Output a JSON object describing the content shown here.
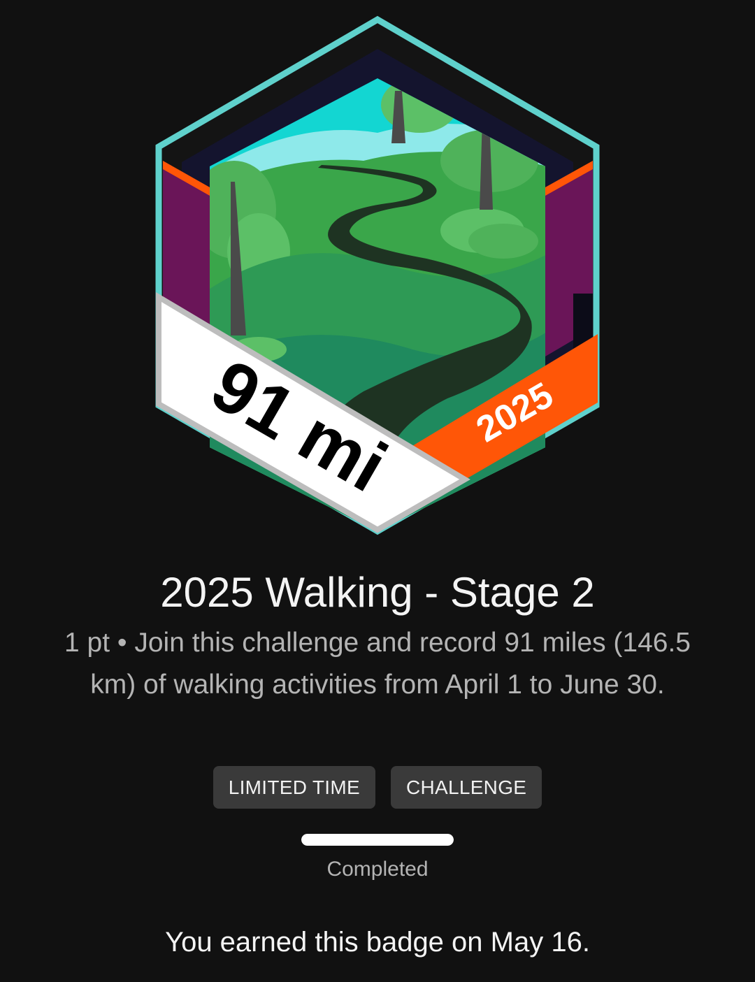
{
  "badge": {
    "distance_text": "91 mi",
    "year_text": "2025",
    "colors": {
      "frame_outline": "#5fd1cc",
      "frame_dark": "#14142e",
      "side_panel": "#6a1558",
      "accent_orange": "#ff5607",
      "banner_white": "#ffffff",
      "banner_border": "#bdbdbd",
      "sky": "#8ee9ea",
      "hill_green": "#4fb25a",
      "path_dark": "#1e3322"
    }
  },
  "title": "2025 Walking - Stage 2",
  "description": "1 pt • Join this challenge and record 91 miles (146.5 km) of walking activities from April 1 to June 30.",
  "tags": [
    "LIMITED TIME",
    "CHALLENGE"
  ],
  "progress": {
    "value": 1.0,
    "status_label": "Completed"
  },
  "earned_message": "You earned this badge on May 16."
}
